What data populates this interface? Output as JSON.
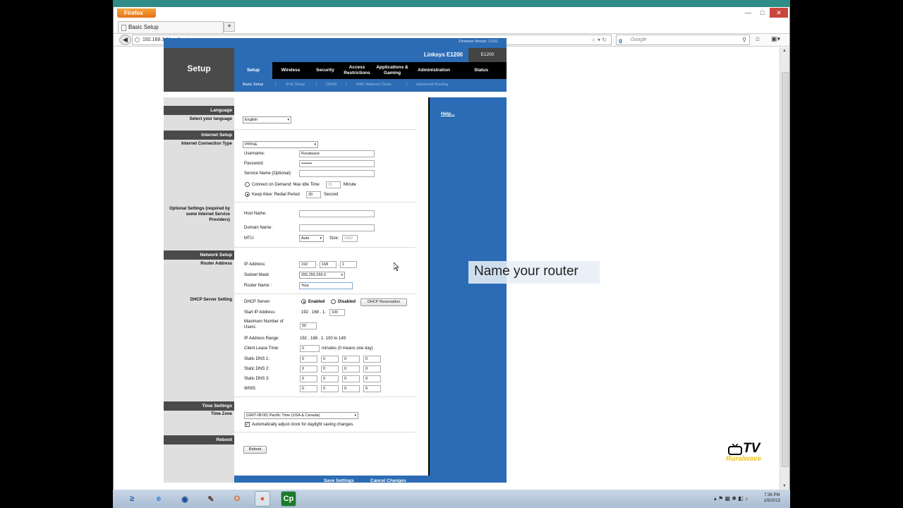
{
  "browser": {
    "app_button": "Firefox",
    "tab_title": "Basic Setup",
    "url": "192.168.1.1/apply.cgi",
    "search_placeholder": "Google"
  },
  "router": {
    "firmware": "Firmware Version: 2.0.01",
    "model_name": "Linksys E1200",
    "model_short": "E1200",
    "page_title": "Setup",
    "tabs": [
      "Setup",
      "Wireless",
      "Security",
      "Access Restrictions",
      "Applications & Gaming",
      "Administration",
      "Status"
    ],
    "subtabs": [
      "Basic Setup",
      "IPv6 Setup",
      "DDNS",
      "MAC Address Clone",
      "Advanced Routing"
    ],
    "help": "Help..."
  },
  "sections": {
    "language": "Language",
    "language_label": "Select your language",
    "internet_setup": "Internet Setup",
    "connection_type_label": "Internet Connection Type",
    "optional_settings": "Optional Settings (required by some Internet Service Providers)",
    "network_setup": "Network Setup",
    "router_address": "Router Address",
    "dhcp_server_setting": "DHCP Server Setting",
    "time_settings": "Time Settings",
    "time_zone_label": "Time Zone",
    "reboot_header": "Reboot"
  },
  "form": {
    "language": "English",
    "connection_type": "PPPoE",
    "username_label": "Username:",
    "username": "Ruralwave",
    "password_label": "Password:",
    "password": "••••••••",
    "service_name_label": "Service Name (Optional):",
    "connect_on_demand": "Connect on Demand: Max Idle Time",
    "idle_time": "15",
    "minute": "Minute",
    "keep_alive": "Keep Alive: Redial Period",
    "redial": "30",
    "second": "Second",
    "host_name_label": "Host Name:",
    "domain_name_label": "Domain Name:",
    "mtu_label": "MTU:",
    "mtu": "Auto",
    "size_label": "Size:",
    "size": "1492",
    "ip_label": "IP Address:",
    "ip": [
      "192",
      "168",
      "1",
      ""
    ],
    "subnet_label": "Subnet Mask:",
    "subnet": "255.255.255.0",
    "router_name_label": "Router Name :",
    "router_name": "Your",
    "dhcp_server_label": "DHCP Server:",
    "enabled": "Enabled",
    "disabled": "Disabled",
    "dhcp_reservation": "DHCP Reservation",
    "start_ip_label": "Start IP Address:",
    "start_ip_prefix": "192 . 168 . 1.",
    "start_ip_last": "100",
    "max_users_label": "Maximum Number of Users:",
    "max_users": "50",
    "ip_range_label": "IP Address Range:",
    "ip_range": "192 . 168 . 1. 100 to 149",
    "lease_label": "Client Lease Time:",
    "lease": "0",
    "lease_note": "minutes (0 means one day)",
    "dns1_label": "Static DNS 1:",
    "dns2_label": "Static DNS 2:",
    "dns3_label": "Static DNS 3:",
    "wins_label": "WINS:",
    "zero": "0",
    "time_zone": "(GMT-08:00) Pacific Time (USA & Canada)",
    "auto_dst": "Automatically adjust clock for daylight saving changes.",
    "reboot": "Reboot"
  },
  "footer": {
    "save": "Save Settings",
    "cancel": "Cancel Changes"
  },
  "overlay": {
    "callout": "Name your router",
    "logo_main": "TV",
    "logo_sub": "Ruralwave"
  },
  "taskbar": {
    "time": "7:36 PM",
    "date": "1/6/2013"
  }
}
